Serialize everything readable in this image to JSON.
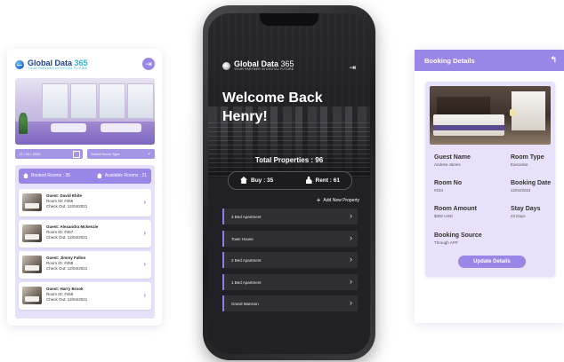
{
  "brand": {
    "name_main": "Global Data",
    "name_num": "365",
    "tagline": "YOUR PARTNER IN DIGITAL FUTURE"
  },
  "left_app": {
    "date_value": "12 / 04 / 2022",
    "room_type_placeholder": "Select Room Type",
    "booked_rooms": "Booked Rooms : 35",
    "available_rooms": "Available Rooms : 21",
    "guests": [
      {
        "name": "Guest: David Ehite",
        "room": "Room ID: #456",
        "checkout": "Check Out: 12/04/2021"
      },
      {
        "name": "Guest: Alexandra Mckenzie",
        "room": "Room ID: #457",
        "checkout": "Check Out: 12/04/2021"
      },
      {
        "name": "Guest: Jimmy Fallon",
        "room": "Room ID: #458",
        "checkout": "Check Out: 12/04/2021"
      },
      {
        "name": "Guest: Harry Brook",
        "room": "Room ID: #459",
        "checkout": "Check Out: 12/04/2021"
      }
    ]
  },
  "phone_app": {
    "welcome_line1": "Welcome Back",
    "welcome_line2": "Henry!",
    "total_properties": "Total Properties : 96",
    "buy": "Buy : 35",
    "rent": "Rent : 61",
    "add_new": "Add New Property",
    "properties": [
      "3 Bed Apartment",
      "Town House",
      "2 Bed Apartment",
      "1 Bed Apartment",
      "Grand Mansion"
    ]
  },
  "booking": {
    "header": "Booking Details",
    "guest_name_label": "Guest Name",
    "guest_name": "Andrew James",
    "room_type_label": "Room Type",
    "room_type": "Executive",
    "room_no_label": "Room No",
    "room_no": "#234",
    "booking_date_label": "Booking Date",
    "booking_date": "12/04/2024",
    "room_amount_label": "Room Amount",
    "room_amount": "$300 USD",
    "stay_days_label": "Stay Days",
    "stay_days": "23 Days",
    "booking_source_label": "Booking Source",
    "booking_source": "Through APP",
    "update_button": "Update Details"
  },
  "colors": {
    "accent": "#9a86e6",
    "panel": "#e7e1fb",
    "phone_bg": "#212125"
  }
}
